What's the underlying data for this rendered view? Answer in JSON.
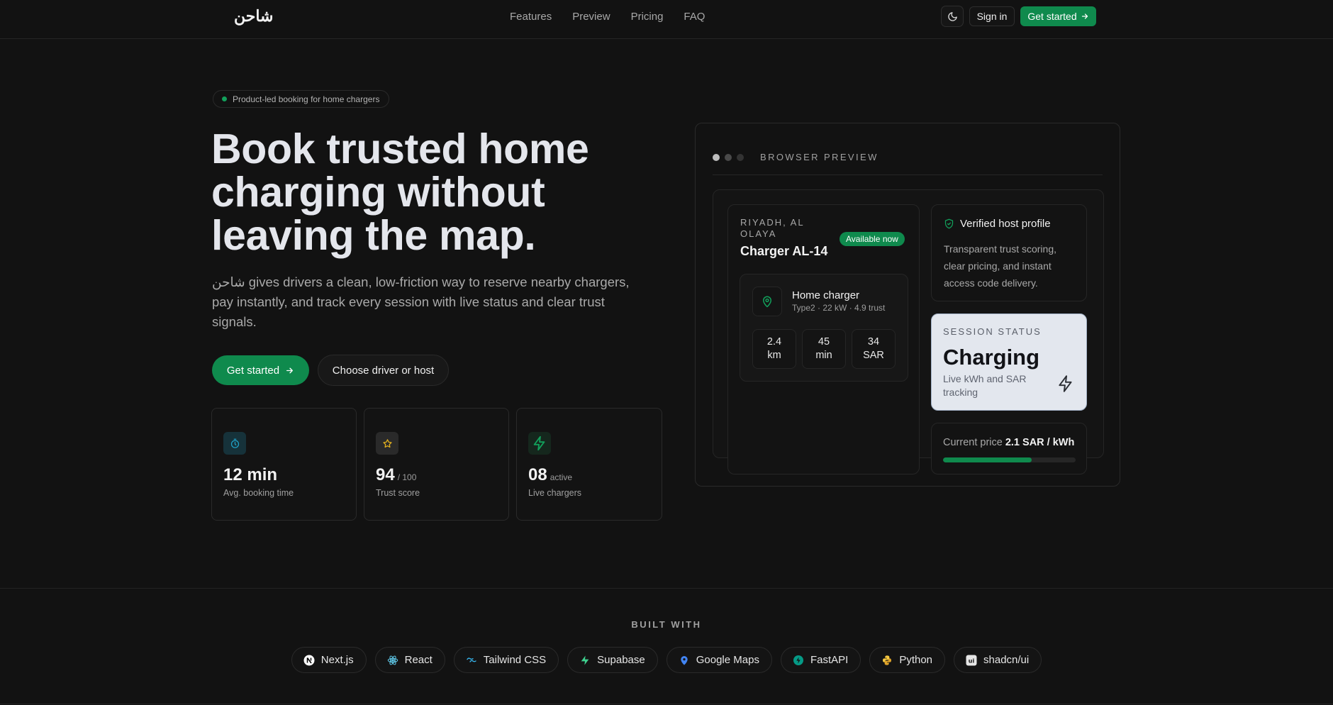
{
  "header": {
    "logo": "شاحن",
    "nav": [
      "Features",
      "Preview",
      "Pricing",
      "FAQ"
    ],
    "sign_in": "Sign in",
    "cta": "Get started"
  },
  "hero": {
    "eyebrow": "Product-led booking for home chargers",
    "title": "Book trusted home charging without leaving the map.",
    "subtitle": "شاحن gives drivers a clean, low-friction way to reserve nearby chargers, pay instantly, and track every session with live status and clear trust signals.",
    "primary_cta": "Get started",
    "secondary_cta": "Choose driver or host"
  },
  "stats": [
    {
      "icon": "timer-icon",
      "value": "12 min",
      "unit": "",
      "label": "Avg. booking time",
      "accent": "#1b8fb0"
    },
    {
      "icon": "star-icon",
      "value": "94",
      "unit": "/ 100",
      "label": "Trust score",
      "accent": "#e6b31e"
    },
    {
      "icon": "bolt-icon",
      "value": "08",
      "unit": "active",
      "label": "Live chargers",
      "accent": "#12a05b"
    }
  ],
  "preview": {
    "label": "BROWSER PREVIEW",
    "charger": {
      "location": "RIYADH, AL OLAYA",
      "name": "Charger AL-14",
      "badge": "Available now",
      "type": "Home charger",
      "specs": "Type2 · 22 kW · 4.9 trust",
      "metrics": [
        {
          "value": "2.4",
          "unit": "km"
        },
        {
          "value": "45",
          "unit": "min"
        },
        {
          "value": "34",
          "unit": "SAR"
        }
      ]
    },
    "host": {
      "title": "Verified host profile",
      "desc": "Transparent trust scoring, clear pricing, and instant access code delivery."
    },
    "session": {
      "label": "SESSION STATUS",
      "value": "Charging",
      "desc": "Live kWh and SAR tracking"
    },
    "price": {
      "label": "Current price",
      "value": "2.1 SAR / kWh",
      "fill_fraction": 0.67
    }
  },
  "built_with": {
    "label": "BUILT WITH",
    "items": [
      {
        "name": "Next.js",
        "icon": "nextjs-icon",
        "color": "#ffffff"
      },
      {
        "name": "React",
        "icon": "react-icon",
        "color": "#5fc8e8"
      },
      {
        "name": "Tailwind CSS",
        "icon": "tailwind-icon",
        "color": "#38bdf8"
      },
      {
        "name": "Supabase",
        "icon": "supabase-icon",
        "color": "#3ecf8e"
      },
      {
        "name": "Google Maps",
        "icon": "google-maps-icon",
        "color": "#4285f4"
      },
      {
        "name": "FastAPI",
        "icon": "fastapi-icon",
        "color": "#059a86"
      },
      {
        "name": "Python",
        "icon": "python-icon",
        "color": "#f7c940"
      },
      {
        "name": "shadcn/ui",
        "icon": "shadcn-icon",
        "color": "#ffffff"
      }
    ]
  },
  "colors": {
    "brand_green": "#0f8a4d",
    "background": "#121212",
    "session_card_bg": "#e3e7ee"
  }
}
